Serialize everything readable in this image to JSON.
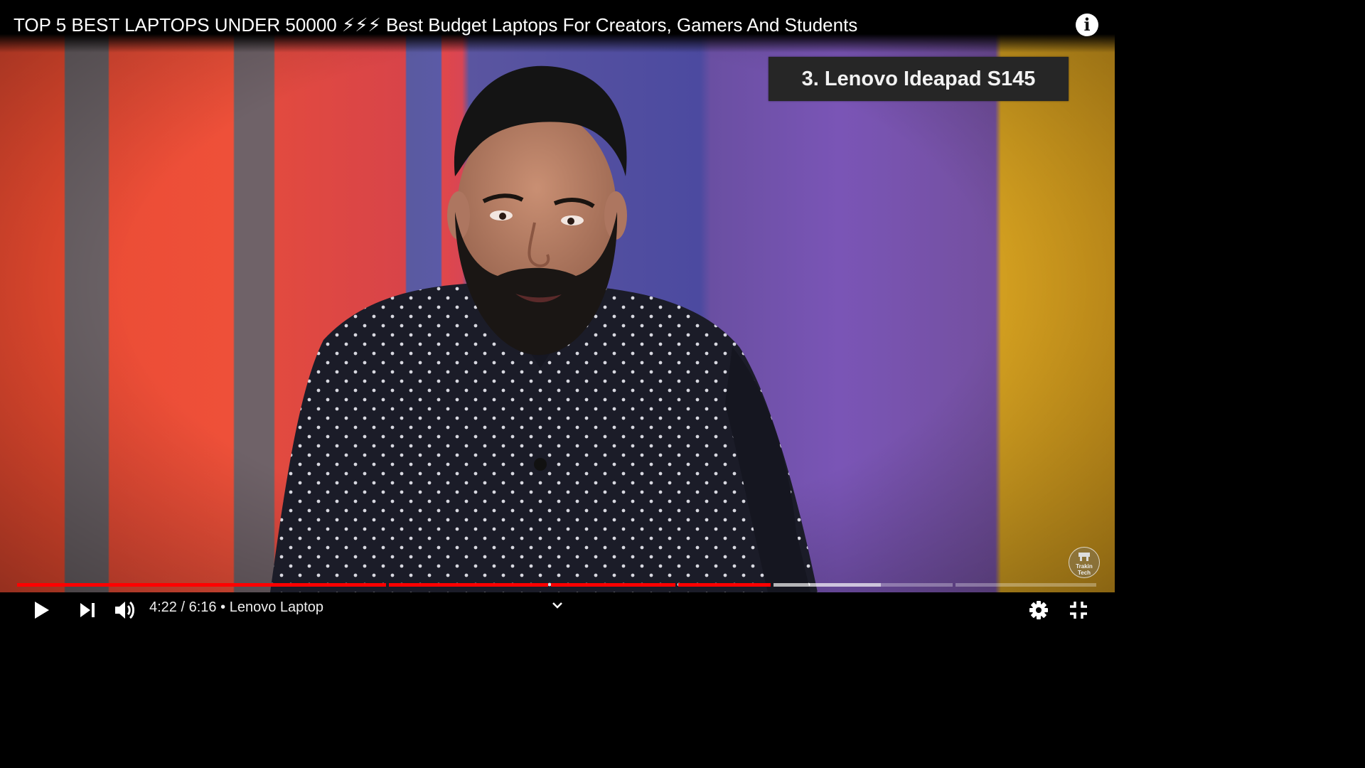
{
  "player": {
    "title": "TOP 5 BEST LAPTOPS UNDER 50000 ⚡⚡⚡ Best Budget Laptops For Creators, Gamers And Students",
    "info_label": "i",
    "overlay": {
      "product_caption": "3. Lenovo Ideapad S145",
      "watermark": "Trakin Tech"
    },
    "progress": {
      "played_fraction": 0.7,
      "chapters": [
        {
          "index": 1,
          "played": 1.0,
          "buffered": 1.0
        },
        {
          "index": 2,
          "played": 1.0,
          "buffered": 1.0
        },
        {
          "index": 3,
          "played": 1.0,
          "buffered": 1.0
        },
        {
          "index": 4,
          "played": 1.0,
          "buffered": 1.0
        },
        {
          "index": 5,
          "played": 0.0,
          "buffered": 0.6
        },
        {
          "index": 6,
          "played": 0.0,
          "buffered": 0.0
        }
      ]
    },
    "controls": {
      "current_time": "4:22",
      "duration": "6:16",
      "separator": "/",
      "chapter_separator": "•",
      "chapter_title": "Lenovo Laptop"
    },
    "icons": [
      "play-icon",
      "next-icon",
      "volume-icon",
      "chevron-down-icon",
      "settings-icon",
      "exit-fullscreen-icon",
      "info-icon"
    ],
    "colors": {
      "progress_played": "#ff0000",
      "caption_bg": "#262626",
      "control_bg": "#000000"
    }
  }
}
